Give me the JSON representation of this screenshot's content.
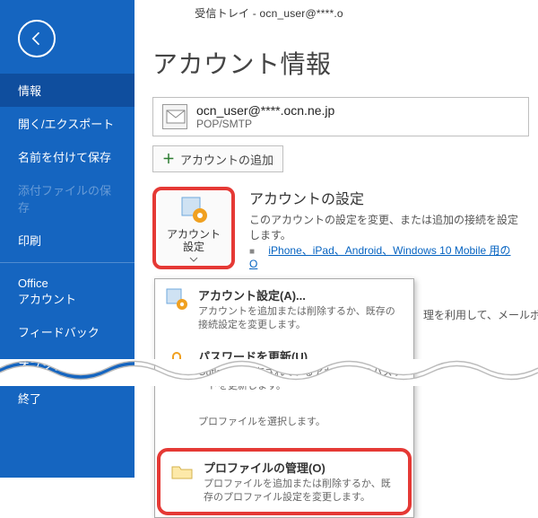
{
  "titlebar": "受信トレイ - ocn_user@****.o",
  "sidebar": {
    "items": [
      {
        "label": "情報",
        "active": true
      },
      {
        "label": "開く/エクスポート"
      },
      {
        "label": "名前を付けて保存"
      },
      {
        "label": "添付ファイルの保存",
        "disabled": true
      },
      {
        "label": "印刷"
      }
    ],
    "items2": [
      {
        "label": "Office\nアカウント"
      },
      {
        "label": "フィードバック"
      },
      {
        "label": "オプション"
      },
      {
        "label": "終了"
      }
    ]
  },
  "main": {
    "title": "アカウント情報",
    "account": {
      "email": "ocn_user@****.ocn.ne.jp",
      "proto": "POP/SMTP"
    },
    "add_account": "アカウントの追加",
    "settings": {
      "btn_label": "アカウント\n設定",
      "heading": "アカウントの設定",
      "desc": "このアカウントの設定を変更、または追加の接続を設定します。",
      "link": "iPhone、iPad、Android、Windows 10 Mobile 用の O"
    },
    "extra_text": "理を利用して、メールボックスの"
  },
  "dropdown": {
    "items": [
      {
        "icon": "account-settings-icon",
        "title": "アカウント設定(A)...",
        "sub": "アカウントを追加または削除するか、既存の接続設定を変更します。"
      },
      {
        "icon": "lock-icon",
        "title": "パスワードを更新(U)",
        "sub": "Outlook に保存されているアカウントのパスワードを更新します。"
      },
      {
        "icon": "profile-select-icon",
        "title": "",
        "sub": "プロファイルを選択します。"
      },
      {
        "icon": "folder-icon",
        "title": "プロファイルの管理(O)",
        "sub": "プロファイルを追加または削除するか、既存のプロファイル設定を変更します。",
        "highlight": true
      }
    ]
  }
}
